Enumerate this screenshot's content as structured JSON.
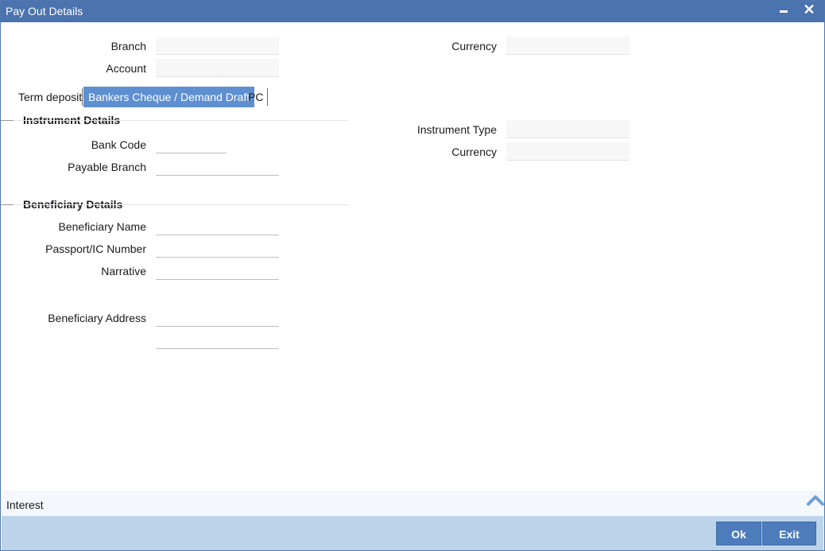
{
  "window": {
    "title": "Pay Out Details"
  },
  "header": {
    "branch_label": "Branch",
    "account_label": "Account",
    "currency_label": "Currency",
    "branch_value": "",
    "account_value": "",
    "currency_value": ""
  },
  "tabs": [
    {
      "label": "Term deposit",
      "active": false
    },
    {
      "label": "Bankers Cheque / Demand Draft",
      "active": true
    },
    {
      "label": "PC",
      "active": false
    }
  ],
  "instrument": {
    "title": "Instrument Details",
    "bank_code_label": "Bank Code",
    "payable_branch_label": "Payable Branch",
    "instrument_type_label": "Instrument Type",
    "currency_label": "Currency"
  },
  "beneficiary": {
    "title": "Beneficiary Details",
    "name_label": "Beneficiary Name",
    "passport_label": "Passport/IC Number",
    "narrative_label": "Narrative",
    "address_label": "Beneficiary Address"
  },
  "interest": {
    "label": "Interest"
  },
  "footer": {
    "ok_label": "Ok",
    "exit_label": "Exit"
  },
  "icons": {
    "minimize": "minimize-icon",
    "close": "close-icon",
    "collapse": "chevron-up-icon"
  },
  "colors": {
    "titlebar": "#4b73ad",
    "active_tab": "#5e8fd0",
    "footer": "#bcd3e9",
    "button": "#4d7cbd"
  }
}
